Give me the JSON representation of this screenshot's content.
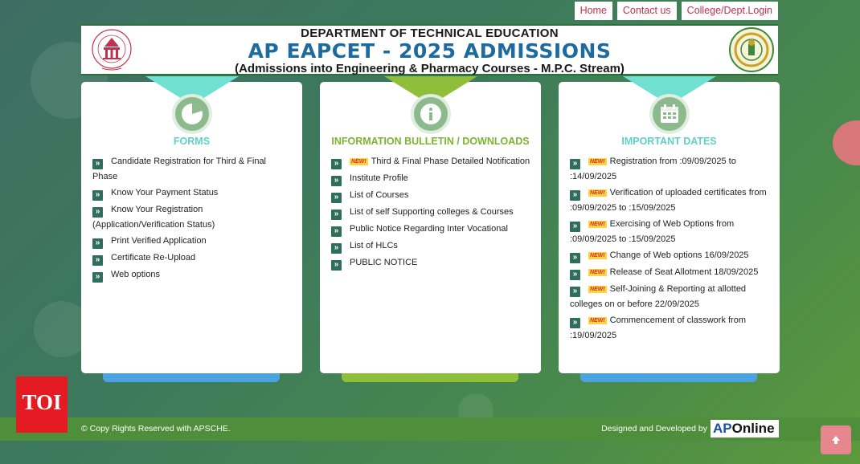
{
  "topnav": [
    "Home",
    "Contact us",
    "College/Dept.Login"
  ],
  "banner": {
    "dept": "DEPARTMENT OF TECHNICAL EDUCATION",
    "title": "AP EAPCET - 2025 ADMISSIONS",
    "subtitle": "(Admissions into Engineering & Pharmacy Courses - M.P.C. Stream)"
  },
  "cards": {
    "forms": {
      "heading": "FORMS",
      "accent": "#6fe0d2",
      "heading_color": "#5fd0c8",
      "icon": "pie-chart-icon",
      "items": [
        "Candidate Registration for Third & Final Phase",
        "Know Your Payment Status",
        "Know Your Registration (Application/Verification Status)",
        "Print Verified Application",
        "Certificate Re-Upload",
        "Web options"
      ]
    },
    "info": {
      "heading": "INFORMATION BULLETIN / DOWNLOADS",
      "accent": "#8fbf3a",
      "heading_color": "#7db432",
      "icon": "info-icon",
      "items": [
        {
          "text": "Third & Final Phase Detailed Notification",
          "new": true
        },
        {
          "text": "Institute Profile",
          "new": false
        },
        {
          "text": "List of Courses",
          "new": false
        },
        {
          "text": "List of self Supporting colleges & Courses",
          "new": false
        },
        {
          "text": "Public Notice Regarding Inter Vocational",
          "new": false
        },
        {
          "text": "List of HLCs",
          "new": false
        },
        {
          "text": "PUBLIC NOTICE",
          "new": false
        }
      ]
    },
    "dates": {
      "heading": "IMPORTANT DATES",
      "accent": "#6fe0d2",
      "heading_color": "#5fd0c8",
      "icon": "calendar-icon",
      "items": [
        "Registration from :09/09/2025 to :14/09/2025",
        "Verification of uploaded certificates from :09/09/2025 to :15/09/2025",
        "Exercising of Web Options from :09/09/2025 to :15/09/2025",
        "Change of Web options 16/09/2025",
        "Release of Seat Allotment 18/09/2025",
        "Self-Joining & Reporting at allotted colleges on or before 22/09/2025",
        "Commencement of classwork from :19/09/2025"
      ]
    }
  },
  "new_tag": "NEW!",
  "footer": {
    "copyright": "© Copy Rights Reserved with APSCHE.",
    "designed": "Designed and Developed by",
    "brand_ap": "AP",
    "brand_online": "Online"
  },
  "watermark": "TOI",
  "logo_left_text": "ANDHRA PRADESH STATE COUNCIL OF HIGHER EDUCATION",
  "colors": {
    "nav_text": "#c0314f",
    "title_blue": "#1c6aa0",
    "footer_green": "#4f8f3c",
    "toi_red": "#e51b23"
  }
}
